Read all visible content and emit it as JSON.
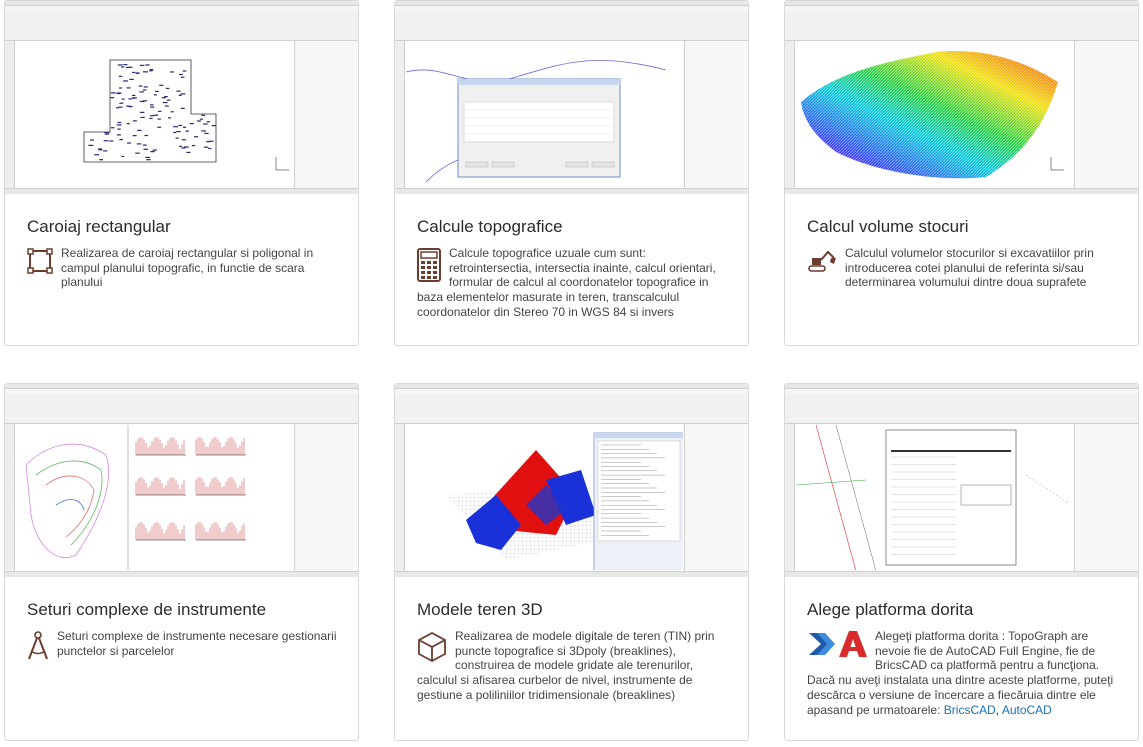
{
  "cards": [
    {
      "title": "Caroiaj rectangular",
      "description": "Realizarea de caroiaj rectangular si poligonal in campul planului topografic, in functie de scara planului",
      "icon": "rectangle-grid-icon"
    },
    {
      "title": "Calcule topografice",
      "description": "Calcule topografice uzuale cum sunt: retrointersectia, intersectia inainte, calcul orientari, formular de calcul al coordonatelor topografice in baza elementelor masurate in teren, transcalculul coordonatelor din Stereo 70 in WGS 84 si invers",
      "icon": "calculator-icon"
    },
    {
      "title": "Calcul volume stocuri",
      "description": "Calculul volumelor stocurilor si excavatiilor prin introducerea cotei planului de referinta si/sau determinarea volumului dintre doua suprafete",
      "icon": "excavator-icon"
    },
    {
      "title": "Seturi complexe de instrumente",
      "description": "Seturi complexe de instrumente necesare gestionarii punctelor si parcelelor",
      "icon": "compass-icon"
    },
    {
      "title": "Modele teren 3D",
      "description": "Realizarea de modele digitale de teren (TIN) prin puncte topografice si 3Dpoly (breaklines), construirea de modele gridate ale terenurilor, calculul si afisarea curbelor de nivel, instrumente de gestiune a poliliniilor tridimensionale (breaklines)",
      "icon": "cube-icon"
    },
    {
      "title": "Alege platforma dorita",
      "description": "Alegeţi platforma dorita : TopoGraph are nevoie fie de AutoCAD Full Engine, fie de BricsCAD ca platformă pentru a funcţiona. Dacă nu aveţi instalata una dintre aceste platforme, puteţi descărca o versiune de încercare a fiecăruia dintre ele apasand pe urmatoarele:",
      "link_bricscad": "BricsCAD",
      "link_sep": ", ",
      "link_autocad": "AutoCAD",
      "icon": "bricscad-autocad-logos"
    }
  ],
  "colors": {
    "title": "#2b2b2b",
    "text": "#444444",
    "link": "#1b6fb5",
    "icon_brown": "#6b3d2e",
    "border": "#d9d9d9"
  }
}
